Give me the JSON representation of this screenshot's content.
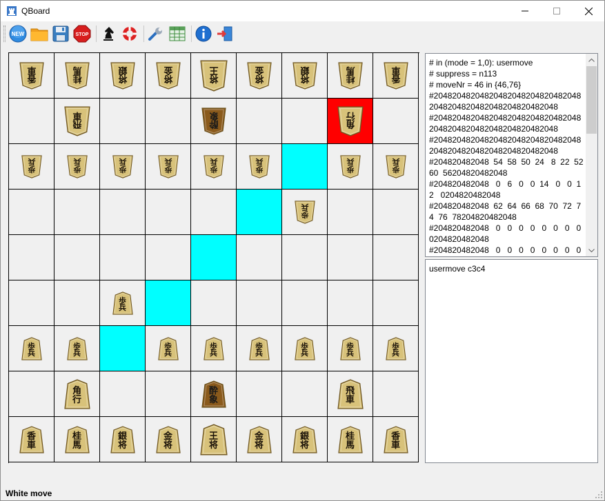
{
  "window": {
    "title": "QBoard"
  },
  "toolbar": {
    "buttons": [
      {
        "name": "new-game-button",
        "icon": "new-badge-icon",
        "label": "NEW"
      },
      {
        "name": "open-button",
        "icon": "folder-icon"
      },
      {
        "name": "save-button",
        "icon": "floppy-disk-icon"
      },
      {
        "name": "stop-button",
        "icon": "stop-sign-icon",
        "label": "STOP"
      },
      {
        "name": "engine-button",
        "icon": "chess-knight-icon"
      },
      {
        "name": "help-button",
        "icon": "lifebuoy-icon"
      },
      {
        "name": "settings-button",
        "icon": "wrench-icon"
      },
      {
        "name": "table-button",
        "icon": "table-icon"
      },
      {
        "name": "info-button",
        "icon": "info-icon"
      },
      {
        "name": "exit-button",
        "icon": "exit-door-icon"
      }
    ]
  },
  "board": {
    "rows": [
      [
        {
          "p": "車",
          "sub": "香",
          "side": "gote"
        },
        {
          "p": "馬",
          "sub": "桂",
          "side": "gote"
        },
        {
          "p": "銀",
          "sub": "将",
          "side": "gote"
        },
        {
          "p": "金",
          "sub": "将",
          "side": "gote"
        },
        {
          "p": "王",
          "sub": "将",
          "side": "gote",
          "king": true
        },
        {
          "p": "金",
          "sub": "将",
          "side": "gote"
        },
        {
          "p": "銀",
          "sub": "将",
          "side": "gote"
        },
        {
          "p": "馬",
          "sub": "桂",
          "side": "gote"
        },
        {
          "p": "車",
          "sub": "香",
          "side": "gote"
        }
      ],
      [
        null,
        {
          "p": "車",
          "sub": "飛",
          "side": "gote",
          "big": true
        },
        null,
        null,
        {
          "p": "象",
          "sub": "酔",
          "side": "gote",
          "promoted": true
        },
        null,
        null,
        {
          "p": "行",
          "sub": "角",
          "side": "gote",
          "big": true,
          "hl": "red"
        },
        null
      ],
      [
        {
          "p": "兵",
          "sub": "歩",
          "side": "gote",
          "small": true
        },
        {
          "p": "兵",
          "sub": "歩",
          "side": "gote",
          "small": true
        },
        {
          "p": "兵",
          "sub": "歩",
          "side": "gote",
          "small": true
        },
        {
          "p": "兵",
          "sub": "歩",
          "side": "gote",
          "small": true
        },
        {
          "p": "兵",
          "sub": "歩",
          "side": "gote",
          "small": true
        },
        {
          "p": "兵",
          "sub": "歩",
          "side": "gote",
          "small": true
        },
        {
          "hl": "cyan"
        },
        {
          "p": "兵",
          "sub": "歩",
          "side": "gote",
          "small": true
        },
        {
          "p": "兵",
          "sub": "歩",
          "side": "gote",
          "small": true
        }
      ],
      [
        null,
        null,
        null,
        null,
        null,
        {
          "hl": "cyan"
        },
        {
          "p": "兵",
          "sub": "歩",
          "side": "gote",
          "small": true
        },
        null,
        null
      ],
      [
        null,
        null,
        null,
        null,
        {
          "hl": "cyan"
        },
        null,
        null,
        null,
        null
      ],
      [
        null,
        null,
        {
          "p": "兵",
          "sub": "歩",
          "side": "sente",
          "small": true
        },
        {
          "hl": "cyan"
        },
        null,
        null,
        null,
        null,
        null
      ],
      [
        {
          "p": "兵",
          "sub": "歩",
          "side": "sente",
          "small": true
        },
        {
          "p": "兵",
          "sub": "歩",
          "side": "sente",
          "small": true
        },
        {
          "hl": "cyan"
        },
        {
          "p": "兵",
          "sub": "歩",
          "side": "sente",
          "small": true
        },
        {
          "p": "兵",
          "sub": "歩",
          "side": "sente",
          "small": true
        },
        {
          "p": "兵",
          "sub": "歩",
          "side": "sente",
          "small": true
        },
        {
          "p": "兵",
          "sub": "歩",
          "side": "sente",
          "small": true
        },
        {
          "p": "兵",
          "sub": "歩",
          "side": "sente",
          "small": true
        },
        {
          "p": "兵",
          "sub": "歩",
          "side": "sente",
          "small": true
        }
      ],
      [
        null,
        {
          "p": "行",
          "sub": "角",
          "side": "sente",
          "big": true
        },
        null,
        null,
        {
          "p": "象",
          "sub": "酔",
          "side": "sente",
          "promoted": true
        },
        null,
        null,
        {
          "p": "車",
          "sub": "飛",
          "side": "sente",
          "big": true
        },
        null
      ],
      [
        {
          "p": "車",
          "sub": "香",
          "side": "sente"
        },
        {
          "p": "馬",
          "sub": "桂",
          "side": "sente"
        },
        {
          "p": "将",
          "sub": "銀",
          "side": "sente"
        },
        {
          "p": "将",
          "sub": "金",
          "side": "sente"
        },
        {
          "p": "将",
          "sub": "王",
          "side": "sente",
          "king": true
        },
        {
          "p": "将",
          "sub": "金",
          "side": "sente"
        },
        {
          "p": "将",
          "sub": "銀",
          "side": "sente"
        },
        {
          "p": "馬",
          "sub": "桂",
          "side": "sente"
        },
        {
          "p": "車",
          "sub": "香",
          "side": "sente"
        }
      ]
    ]
  },
  "log": {
    "lines": [
      "# in (mode = 1,0): usermove",
      "# suppress = n113",
      "# moveNr = 46 in {46,76}",
      "#204820482048204820482048204820482048204820482048204820482048",
      "#204820482048204820482048204820482048204820482048204820482048",
      "#204820482048204820482048204820482048204820482048204820482048",
      "#204820482048  54  58  50  24   8  22  52  60  56204820482048",
      "#204820482048   0   6   0   0  14   0   0  12   0204820482048",
      "#204820482048  62  64  66  68  70  72  74  76  78204820482048",
      "#204820482048   0   0   0   0   0   0   0   0   0204820482048",
      "#204820482048   0   0   0   0   0   0   0   0"
    ]
  },
  "input": {
    "text": "usermove c3c4"
  },
  "status": {
    "text": "White move"
  },
  "colors": {
    "highlight": "#00ffff",
    "selected": "#ff0000",
    "piece": "#d8c27a",
    "promoted_piece": "#8a5a1c"
  }
}
